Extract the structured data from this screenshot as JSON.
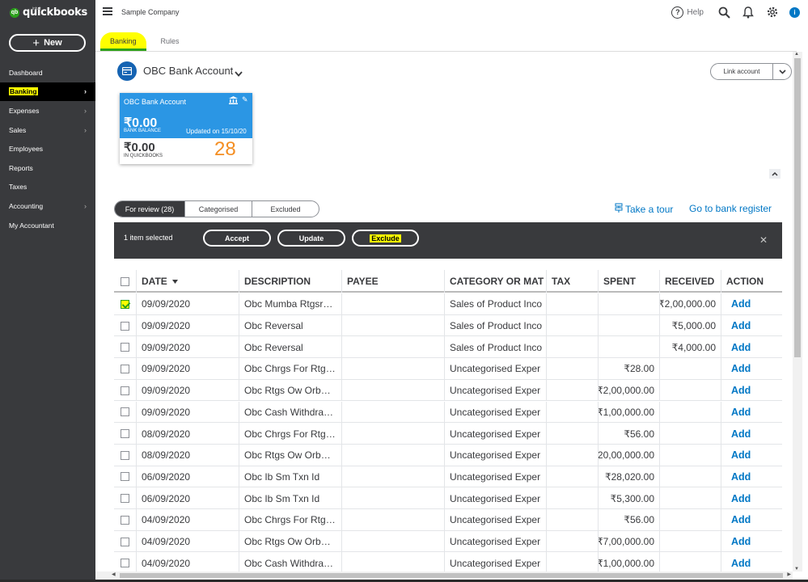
{
  "app": {
    "logo_sup": "intuit",
    "logo_text": "quickbooks",
    "logo_mark": "qb"
  },
  "sidebar": {
    "new_label": "New",
    "items": [
      {
        "label": "Dashboard",
        "has_chevron": false
      },
      {
        "label": "Banking",
        "has_chevron": true,
        "active": true
      },
      {
        "label": "Expenses",
        "has_chevron": true
      },
      {
        "label": "Sales",
        "has_chevron": true
      },
      {
        "label": "Employees",
        "has_chevron": false
      },
      {
        "label": "Reports",
        "has_chevron": false
      },
      {
        "label": "Taxes",
        "has_chevron": false
      },
      {
        "label": "Accounting",
        "has_chevron": true
      },
      {
        "label": "My Accountant",
        "has_chevron": false
      }
    ]
  },
  "header": {
    "company": "Sample Company",
    "help_label": "Help",
    "avatar_letter": "i"
  },
  "tabs": [
    {
      "label": "Banking",
      "active": true
    },
    {
      "label": "Rules"
    }
  ],
  "account": {
    "name": "OBC Bank Account",
    "link_label": "Link account"
  },
  "card": {
    "title": "OBC Bank Account",
    "bank_balance": "₹0.00",
    "bank_balance_label": "BANK BALANCE",
    "updated": "Updated on 15/10/20",
    "qb_balance": "₹0.00",
    "qb_label": "IN QUICKBOOKS",
    "count": "28"
  },
  "filters": [
    {
      "label": "For review (28)",
      "active": true
    },
    {
      "label": "Categorised"
    },
    {
      "label": "Excluded"
    }
  ],
  "links": {
    "take_tour": "Take a tour",
    "bank_register": "Go to bank register"
  },
  "batch": {
    "selected": "1 item selected",
    "accept": "Accept",
    "update": "Update",
    "exclude": "Exclude"
  },
  "table": {
    "headers": {
      "date": "DATE",
      "description": "DESCRIPTION",
      "payee": "PAYEE",
      "category": "CATEGORY OR MAT",
      "tax": "TAX",
      "spent": "SPENT",
      "received": "RECEIVED",
      "action": "ACTION"
    },
    "rows": [
      {
        "checked": true,
        "date": "09/09/2020",
        "description": "Obc Mumba Rtgsr…",
        "payee": "",
        "category": "Sales of Product Inco",
        "tax": "",
        "spent": "",
        "received": "₹2,00,000.00",
        "action": "Add"
      },
      {
        "checked": false,
        "date": "09/09/2020",
        "description": "Obc Reversal",
        "payee": "",
        "category": "Sales of Product Inco",
        "tax": "",
        "spent": "",
        "received": "₹5,000.00",
        "action": "Add"
      },
      {
        "checked": false,
        "date": "09/09/2020",
        "description": "Obc Reversal",
        "payee": "",
        "category": "Sales of Product Inco",
        "tax": "",
        "spent": "",
        "received": "₹4,000.00",
        "action": "Add"
      },
      {
        "checked": false,
        "date": "09/09/2020",
        "description": "Obc Chrgs For Rtg…",
        "payee": "",
        "category": "Uncategorised Exper",
        "tax": "",
        "spent": "₹28.00",
        "received": "",
        "action": "Add"
      },
      {
        "checked": false,
        "date": "09/09/2020",
        "description": "Obc Rtgs Ow Orb…",
        "payee": "",
        "category": "Uncategorised Exper",
        "tax": "",
        "spent": "₹2,00,000.00",
        "received": "",
        "action": "Add"
      },
      {
        "checked": false,
        "date": "09/09/2020",
        "description": "Obc Cash Withdra…",
        "payee": "",
        "category": "Uncategorised Exper",
        "tax": "",
        "spent": "₹1,00,000.00",
        "received": "",
        "action": "Add"
      },
      {
        "checked": false,
        "date": "08/09/2020",
        "description": "Obc Chrgs For Rtg…",
        "payee": "",
        "category": "Uncategorised Exper",
        "tax": "",
        "spent": "₹56.00",
        "received": "",
        "action": "Add"
      },
      {
        "checked": false,
        "date": "08/09/2020",
        "description": "Obc Rtgs Ow Orb…",
        "payee": "",
        "category": "Uncategorised Exper",
        "tax": "",
        "spent": "₹20,00,000.00",
        "received": "",
        "action": "Add"
      },
      {
        "checked": false,
        "date": "06/09/2020",
        "description": "Obc Ib Sm Txn Id",
        "payee": "",
        "category": "Uncategorised Exper",
        "tax": "",
        "spent": "₹28,020.00",
        "received": "",
        "action": "Add"
      },
      {
        "checked": false,
        "date": "06/09/2020",
        "description": "Obc Ib Sm Txn Id",
        "payee": "",
        "category": "Uncategorised Exper",
        "tax": "",
        "spent": "₹5,300.00",
        "received": "",
        "action": "Add"
      },
      {
        "checked": false,
        "date": "04/09/2020",
        "description": "Obc Chrgs For Rtg…",
        "payee": "",
        "category": "Uncategorised Exper",
        "tax": "",
        "spent": "₹56.00",
        "received": "",
        "action": "Add"
      },
      {
        "checked": false,
        "date": "04/09/2020",
        "description": "Obc Rtgs Ow Orb…",
        "payee": "",
        "category": "Uncategorised Exper",
        "tax": "",
        "spent": "₹7,00,000.00",
        "received": "",
        "action": "Add"
      },
      {
        "checked": false,
        "date": "04/09/2020",
        "description": "Obc Cash Withdra…",
        "payee": "",
        "category": "Uncategorised Exper",
        "tax": "",
        "spent": "₹1,00,000.00",
        "received": "",
        "action": "Add"
      }
    ]
  },
  "colors": {
    "sidebar": "#393a3d",
    "brand_green": "#2ca01c",
    "link_blue": "#0077c5",
    "card_blue": "#2b96e4",
    "highlight": "#ffff00",
    "count_orange": "#f48e22"
  }
}
